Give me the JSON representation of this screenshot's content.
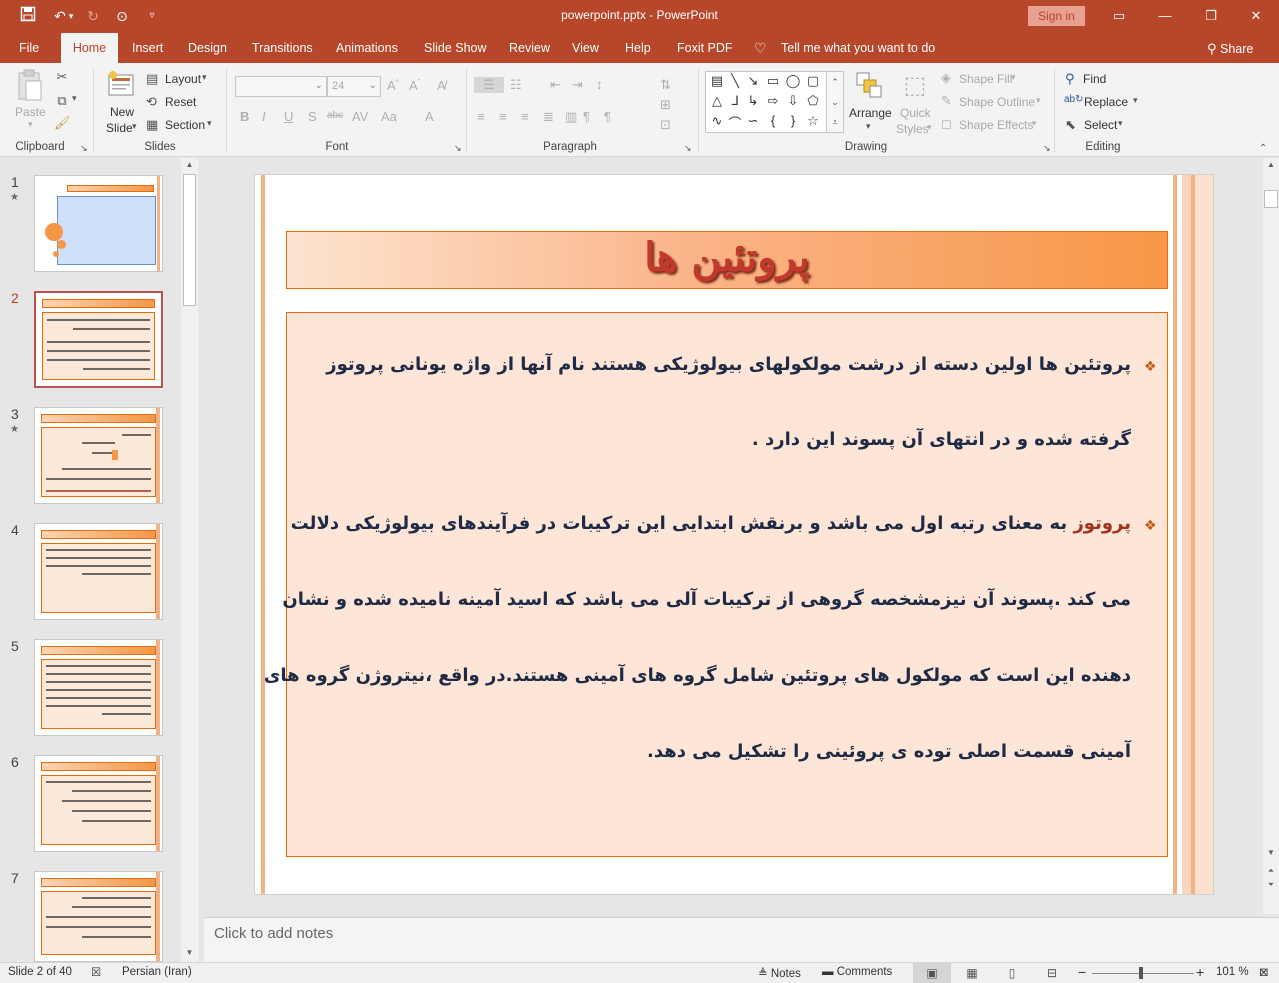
{
  "window": {
    "title": "powerpoint.pptx  -  PowerPoint",
    "signin": "Sign in"
  },
  "qat": {
    "save": "save-icon",
    "undo": "undo-icon",
    "redo": "redo-icon",
    "present": "present-icon",
    "customize": "customize-icon"
  },
  "tabs": [
    "File",
    "Home",
    "Insert",
    "Design",
    "Transitions",
    "Animations",
    "Slide Show",
    "Review",
    "View",
    "Help",
    "Foxit PDF"
  ],
  "tell_me": "Tell me what you want to do",
  "share": "Share",
  "ribbon": {
    "clipboard": {
      "paste": "Paste",
      "label": "Clipboard"
    },
    "slides": {
      "new_slide": "New",
      "new_slide2": "Slide",
      "layout": "Layout",
      "reset": "Reset",
      "section": "Section",
      "label": "Slides"
    },
    "font": {
      "size": "24",
      "label": "Font"
    },
    "paragraph": {
      "label": "Paragraph"
    },
    "drawing": {
      "arrange": "Arrange",
      "quick_styles": "Quick",
      "quick_styles2": "Styles",
      "shape_fill": "Shape Fill",
      "shape_outline": "Shape Outline",
      "shape_effects": "Shape Effects",
      "label": "Drawing"
    },
    "editing": {
      "find": "Find",
      "replace": "Replace",
      "select": "Select",
      "label": "Editing"
    }
  },
  "thumbnails": [
    {
      "num": "1",
      "star": true
    },
    {
      "num": "2",
      "star": false,
      "selected": true
    },
    {
      "num": "3",
      "star": true
    },
    {
      "num": "4",
      "star": false
    },
    {
      "num": "5",
      "star": false
    },
    {
      "num": "6",
      "star": false
    },
    {
      "num": "7",
      "star": false
    }
  ],
  "slide": {
    "title": "پروتئین ها",
    "p1_line1": "پروتئین ها اولین دسته از درشت مولکولهای بیولوژیکی هستند نام آنها از واژه یونانی پروتوز",
    "p1_line2": "گرفته شده و در انتهای آن پسوند این دارد .",
    "p2_highlight": "پروتوز",
    "p2_line1_rest": " به معنای رتبه اول می باشد و برنقش ابتدایی این ترکیبات در فرآیندهای بیولوژیکی دلالت",
    "p2_line2": "می کند .پسوند آن نیزمشخصه گروهی از ترکیبات آلی می باشد که اسید آمینه نامیده شده و نشان",
    "p2_line3": "دهنده این است که مولکول های پروتئین شامل گروه های آمینی هستند.در واقع ،نیتروژن گروه های",
    "p2_line4": "آمینی قسمت اصلی توده ی پروئینی را تشکیل می دهد."
  },
  "notes_placeholder": "Click to add notes",
  "status": {
    "slide_info": "Slide 2 of 40",
    "language": "Persian (Iran)",
    "notes": "Notes",
    "comments": "Comments",
    "zoom": "101 %"
  },
  "colors": {
    "accent": "#b7472a",
    "title_text": "#c0392b",
    "body_text": "#1f2a44",
    "body_fill": "#fde5d8"
  }
}
